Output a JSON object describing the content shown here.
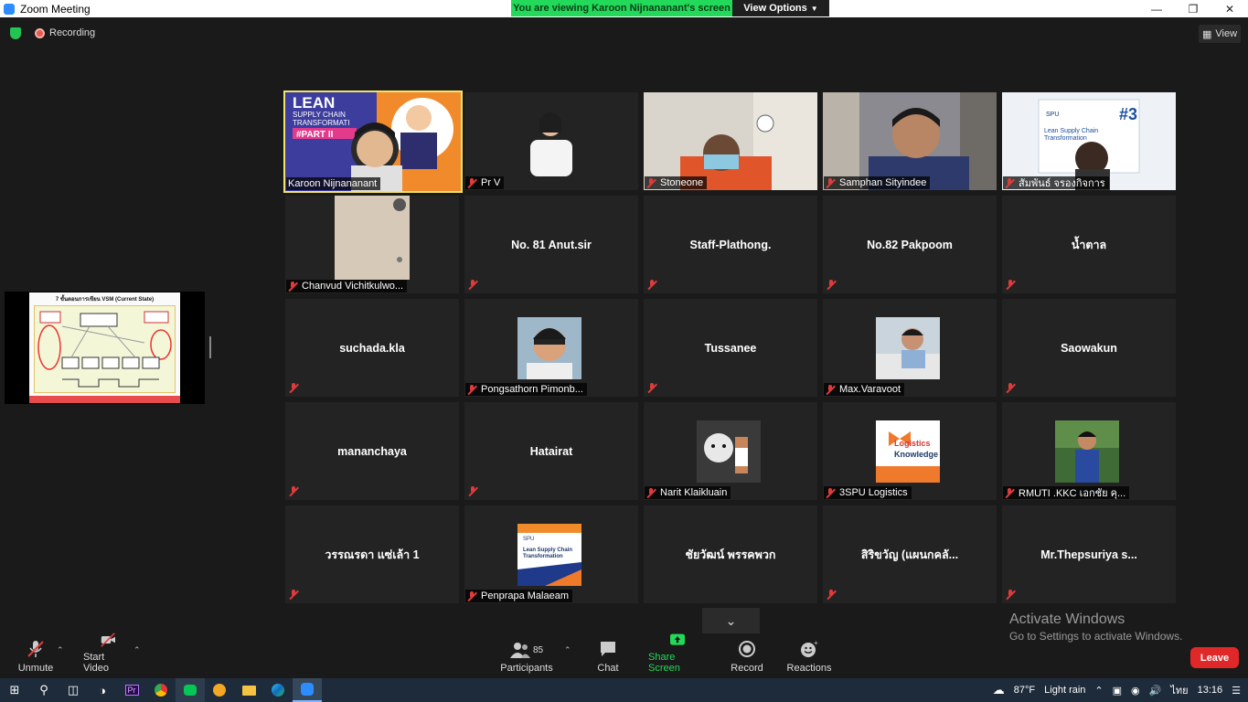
{
  "window": {
    "title": "Zoom Meeting"
  },
  "banner": {
    "viewing": "You are viewing Karoon Nijnananant's screen",
    "view_options": "View Options"
  },
  "status": {
    "recording": "Recording",
    "view": "View"
  },
  "tiles": [
    {
      "name": "Karoon Nijnananant",
      "kind": "video"
    },
    {
      "name": "Pr V",
      "kind": "video"
    },
    {
      "name": "Stoneone",
      "kind": "video"
    },
    {
      "name": "Samphan Sityindee",
      "kind": "video"
    },
    {
      "name": "สัมพันธ์ จรองกิจการ",
      "kind": "video"
    },
    {
      "name": "Chanvud Vichitkulwo...",
      "kind": "video"
    },
    {
      "name": "No. 81 Anut.sir",
      "kind": "name"
    },
    {
      "name": "Staff-Plathong.",
      "kind": "name"
    },
    {
      "name": "No.82 Pakpoom",
      "kind": "name"
    },
    {
      "name": "น้ำตาล",
      "kind": "name"
    },
    {
      "name": "suchada.kla",
      "kind": "name"
    },
    {
      "name": "Pongsathorn Pimonb...",
      "kind": "avatar"
    },
    {
      "name": "Tussanee",
      "kind": "name"
    },
    {
      "name": "Max.Varavoot",
      "kind": "avatar"
    },
    {
      "name": "Saowakun",
      "kind": "name"
    },
    {
      "name": "mananchaya",
      "kind": "name"
    },
    {
      "name": "Hatairat",
      "kind": "name"
    },
    {
      "name": "Narit Klaikluain",
      "kind": "avatar"
    },
    {
      "name": "3SPU Logistics",
      "kind": "avatar"
    },
    {
      "name": "RMUTI .KKC เอกชัย คุ...",
      "kind": "avatar"
    },
    {
      "name": "วรรณรดา แซ่เล้า 1",
      "kind": "name"
    },
    {
      "name": "Penprapa Malaeam",
      "kind": "avatar"
    },
    {
      "name": "ชัยวัฒน์ พรรคพวก",
      "kind": "name"
    },
    {
      "name": "สิริขวัญ (แผนกคลั...",
      "kind": "name"
    },
    {
      "name": "Mr.Thepsuriya   s...",
      "kind": "name"
    }
  ],
  "slide": {
    "title": "7 ขั้นตอนการเขียน VSM (Current State)"
  },
  "toolbar": {
    "unmute": "Unmute",
    "start_video": "Start Video",
    "participants": "Participants",
    "participants_count": "85",
    "chat": "Chat",
    "share_screen": "Share Screen",
    "record": "Record",
    "reactions": "Reactions",
    "leave": "Leave"
  },
  "watermark": {
    "line1": "Activate Windows",
    "line2": "Go to Settings to activate Windows."
  },
  "taskbar": {
    "weather_temp": "87°F",
    "weather_text": "Light rain",
    "lang": "ไทย",
    "time": "13:16"
  },
  "colors": {
    "accent_green": "#23d959",
    "active_border": "#f1e46e",
    "leave_red": "#e02828"
  }
}
